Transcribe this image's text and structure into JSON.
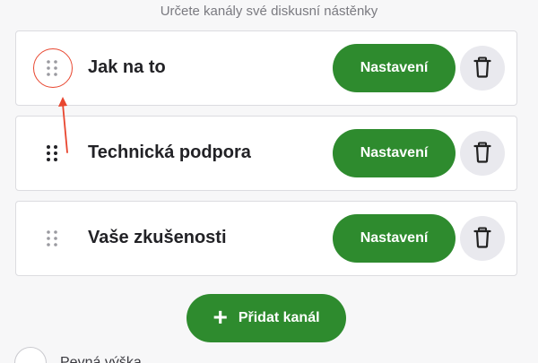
{
  "subtitle": "Určete kanály své diskusní nástěnky",
  "channels": [
    {
      "name": "Jak na to",
      "settings_label": "Nastavení"
    },
    {
      "name": "Technická podpora",
      "settings_label": "Nastavení"
    },
    {
      "name": "Vaše zkušenosti",
      "settings_label": "Nastavení"
    }
  ],
  "add_channel_label": "Přidat kanál",
  "add_channel_icon": "plus-icon",
  "fixed_height_label": "Pevná výška",
  "colors": {
    "accent": "#2e8b2e",
    "annotation": "#e8462f",
    "delete_bg": "#e9e9ee"
  },
  "icons": {
    "drag": "drag-handle-icon",
    "delete": "trash-icon"
  }
}
